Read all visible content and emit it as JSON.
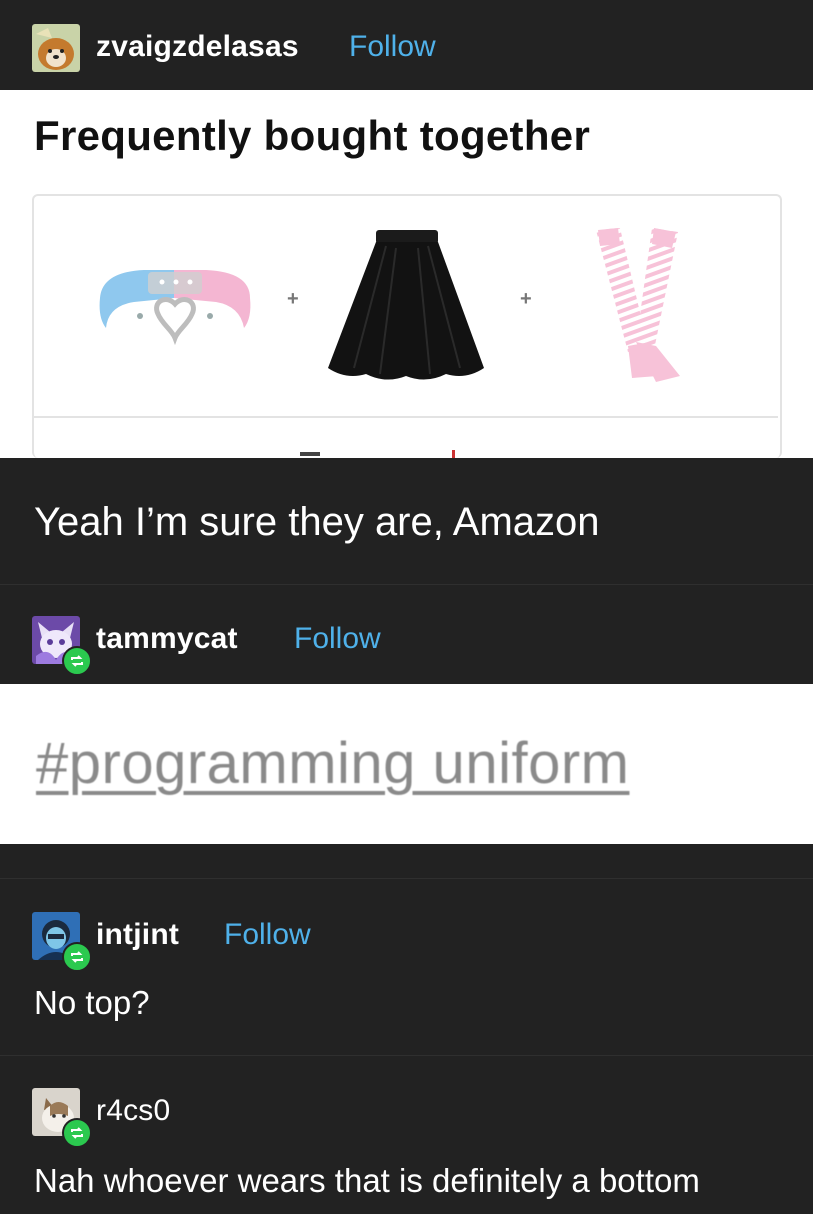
{
  "post1": {
    "username": "zvaigzdelasas",
    "follow_label": "Follow",
    "image": {
      "heading": "Frequently bought together",
      "items": [
        "choker-icon",
        "skirt-icon",
        "arm-warmers-icon"
      ],
      "plus": "+"
    },
    "text": "Yeah I’m sure they are, Amazon"
  },
  "post2": {
    "username": "tammycat",
    "follow_label": "Follow",
    "tag_image_text": "#programming uniform"
  },
  "post3": {
    "username": "intjint",
    "follow_label": "Follow",
    "text": "No top?"
  },
  "post4": {
    "username": "r4cs0",
    "text": "Nah whoever wears that is definitely a bottom"
  },
  "colors": {
    "background": "#222222",
    "follow": "#4fb1ea",
    "reblog_badge": "#2bc94f"
  }
}
